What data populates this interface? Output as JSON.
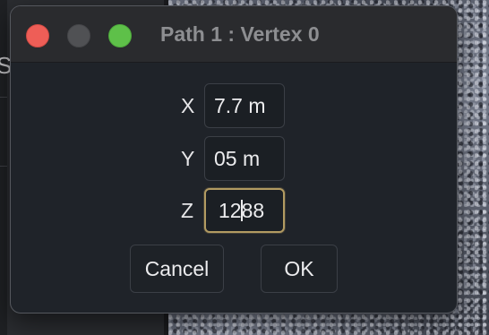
{
  "window": {
    "title": "Path 1 : Vertex 0"
  },
  "background": {
    "left_panel_letter": "S"
  },
  "fields": {
    "x": {
      "label": "X",
      "value": "7.7 m"
    },
    "y": {
      "label": "Y",
      "value": "05 m"
    },
    "z": {
      "label": "Z",
      "value_before_caret": "12",
      "value_after_caret": "88"
    }
  },
  "buttons": {
    "cancel_label": "Cancel",
    "ok_label": "OK"
  },
  "colors": {
    "close": "#ee5e57",
    "minimize": "#505154",
    "zoom": "#5ec049",
    "focus_ring": "#b29b62",
    "dialog_bg": "#1f2329",
    "titlebar_bg": "#2a2b2e"
  },
  "icons": {
    "close": "close-traffic-light-icon",
    "minimize": "minimize-traffic-light-icon",
    "zoom": "zoom-traffic-light-icon"
  }
}
